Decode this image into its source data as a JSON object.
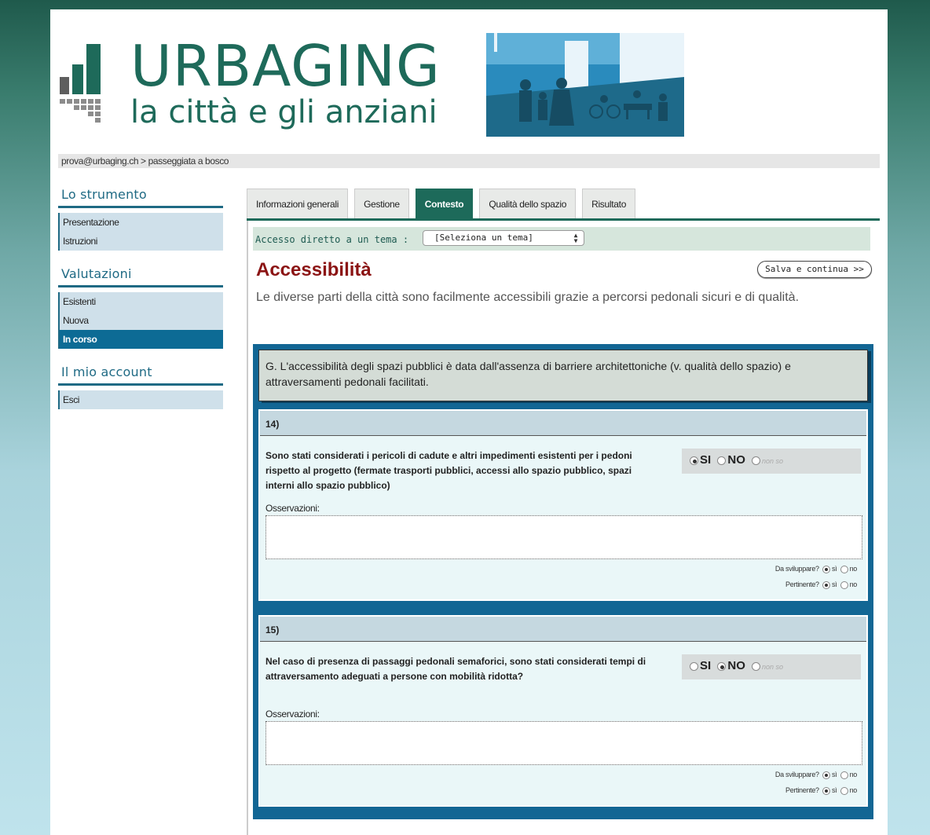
{
  "header": {
    "brand": "URBAGING",
    "tagline": "la città e gli anziani"
  },
  "breadcrumb": "prova@urbaging.ch > passeggiata a bosco",
  "sidebar": {
    "sections": [
      {
        "title": "Lo strumento",
        "items": [
          {
            "label": "Presentazione"
          },
          {
            "label": "Istruzioni"
          }
        ]
      },
      {
        "title": "Valutazioni",
        "items": [
          {
            "label": "Esistenti"
          },
          {
            "label": "Nuova"
          },
          {
            "label": "In corso",
            "active": true
          }
        ]
      },
      {
        "title": "Il mio account",
        "items": [
          {
            "label": "Esci"
          }
        ]
      }
    ]
  },
  "tabs": [
    {
      "label": "Informazioni generali"
    },
    {
      "label": "Gestione"
    },
    {
      "label": "Contesto",
      "active": true
    },
    {
      "label": "Qualità dello spazio"
    },
    {
      "label": "Risultato"
    }
  ],
  "access": {
    "label": "Accesso diretto a un tema :",
    "select_value": "[Seleziona un tema]"
  },
  "save_label": "Salva e continua >>",
  "title": "Accessibilità",
  "intro": "Le diverse parti della città sono facilmente accessibili grazie a percorsi pedonali sicuri e di qualità.",
  "group_text": "G. L'accessibilità degli spazi pubblici è data dall'assenza di barriere architettoniche (v. qualità dello spazio) e attraversamenti pedonali facilitati.",
  "options": {
    "si": "SI",
    "no": "NO",
    "nonso": "non so"
  },
  "oss_label": "Osservazioni:",
  "sviluppare_label": "Da sviluppare?",
  "pertinente_label": "Pertinente?",
  "yes_small": "sì",
  "no_small": "no",
  "questions": [
    {
      "number": "14)",
      "text": "Sono stati considerati i pericoli di cadute e altri impedimenti esistenti per i pedoni rispetto al progetto (fermate trasporti pubblici, accessi allo spazio pubblico, spazi interni allo spazio pubblico)",
      "answer": "si",
      "sviluppare": "si",
      "pertinente": "si"
    },
    {
      "number": "15)",
      "text": "Nel caso di presenza di passaggi pedonali semaforici, sono stati considerati tempi di attraversamento adeguati a persone con mobilità ridotta?",
      "answer": "no",
      "sviluppare": "si",
      "pertinente": "si"
    }
  ]
}
